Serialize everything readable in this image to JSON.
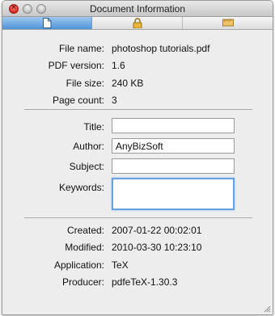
{
  "window": {
    "title": "Document Information"
  },
  "tabs": [
    {
      "name": "general",
      "icon": "document-icon"
    },
    {
      "name": "security",
      "icon": "lock-icon"
    },
    {
      "name": "fonts",
      "icon": "ruler-icon"
    }
  ],
  "file_info": {
    "file_name_label": "File name:",
    "file_name": "photoshop tutorials.pdf",
    "pdf_version_label": "PDF version:",
    "pdf_version": "1.6",
    "file_size_label": "File size:",
    "file_size": "240 KB",
    "page_count_label": "Page count:",
    "page_count": "3"
  },
  "metadata_fields": {
    "title_label": "Title:",
    "title_value": "",
    "author_label": "Author:",
    "author_value": "AnyBizSoft",
    "subject_label": "Subject:",
    "subject_value": "",
    "keywords_label": "Keywords:",
    "keywords_value": ""
  },
  "dates": {
    "created_label": "Created:",
    "created": "2007-01-22 00:02:01",
    "modified_label": "Modified:",
    "modified": "2010-03-30 10:23:10",
    "application_label": "Application:",
    "application": "TeX",
    "producer_label": "Producer:",
    "producer": "pdfeTeX-1.30.3"
  },
  "colors": {
    "selected_tab": "#4f93d6",
    "focus_ring": "#6aa1e0",
    "close_button": "#d3271e"
  }
}
